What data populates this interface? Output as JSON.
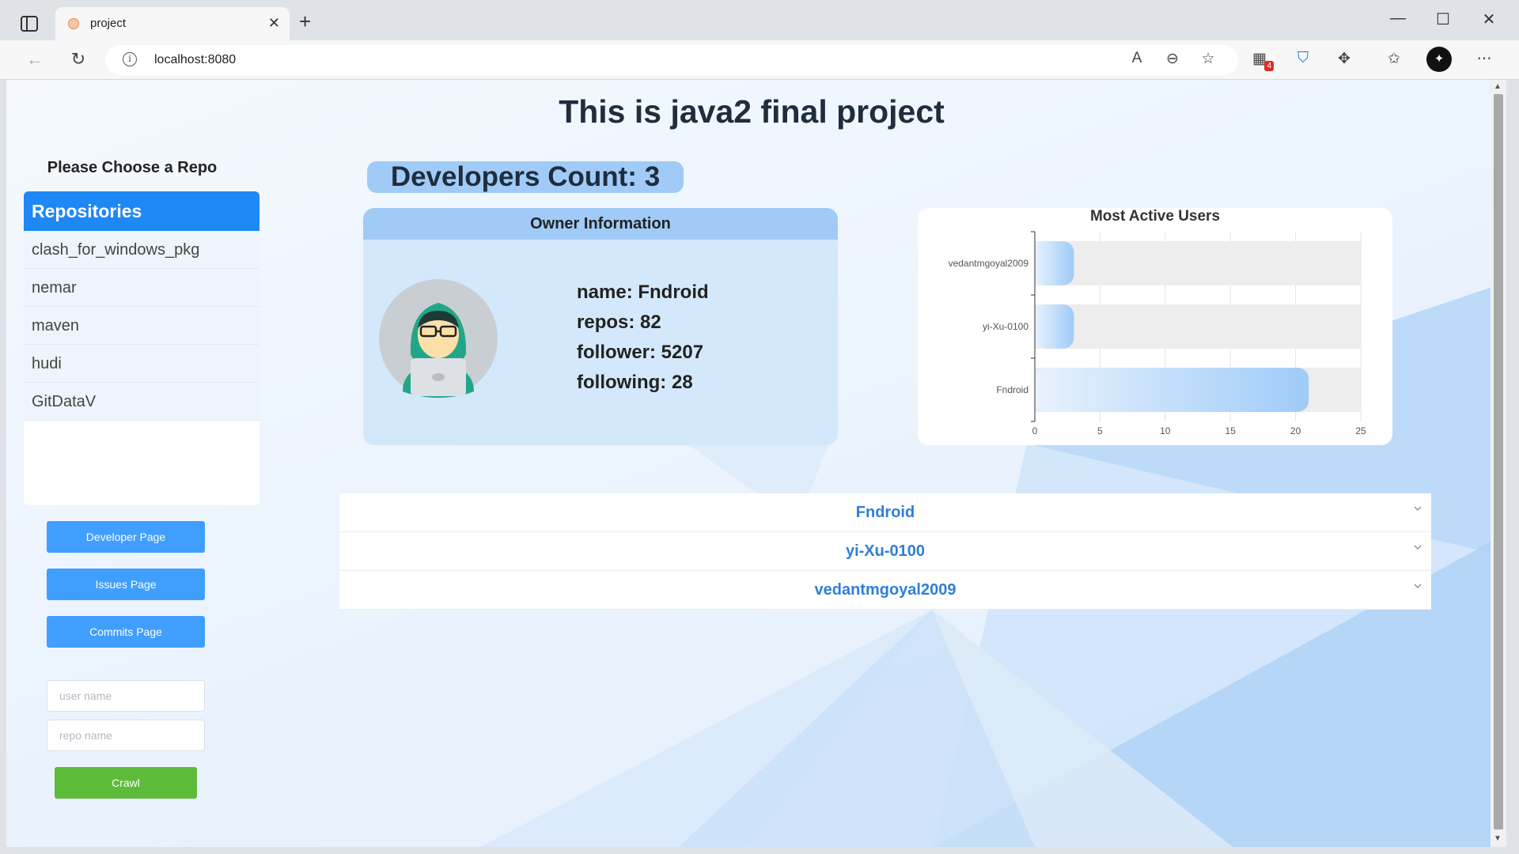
{
  "browser": {
    "tab_title": "project",
    "url": "localhost:8080",
    "extensions_badge": "4",
    "icons": [
      "sidebar-icon",
      "close-icon",
      "plus-icon",
      "minimize-icon",
      "maximize-icon",
      "back-icon",
      "refresh-icon",
      "info-icon",
      "read-aloud-icon",
      "zoom-out-icon",
      "favorite-add-icon",
      "extensions-icon",
      "shield-icon",
      "puzzle-icon",
      "favorites-icon",
      "profile-icon",
      "more-icon"
    ]
  },
  "page": {
    "title": "This is java2 final project"
  },
  "sidebar": {
    "choose_label": "Please Choose a Repo",
    "repo_header": "Repositories",
    "repos": [
      "clash_for_windows_pkg",
      "nemar",
      "maven",
      "hudi",
      "GitDataV"
    ],
    "buttons": {
      "developer": "Developer Page",
      "issues": "Issues Page",
      "commits": "Commits Page"
    },
    "inputs": {
      "user_placeholder": "user name",
      "repo_placeholder": "repo name"
    },
    "crawl": "Crawl"
  },
  "developers": {
    "count_label": "Developers Count: 3"
  },
  "owner": {
    "header": "Owner Information",
    "name_line": "name: Fndroid",
    "repos_line": "repos: 82",
    "follower_line": "follower: 5207",
    "following_line": "following: 28"
  },
  "collapse": {
    "items": [
      "Fndroid",
      "yi-Xu-0100",
      "vedantmgoyal2009"
    ]
  },
  "colors": {
    "accent": "#1e88f5",
    "button": "#409eff",
    "crawl": "#5dbb3a",
    "collapse_title": "#2f7fd6"
  },
  "chart_data": {
    "type": "bar",
    "orientation": "horizontal",
    "title": "Most Active Users",
    "categories": [
      "Fndroid",
      "yi-Xu-0100",
      "vedantmgoyal2009"
    ],
    "values": [
      21,
      3,
      3
    ],
    "xlim": [
      0,
      25
    ],
    "xticks": [
      0,
      5,
      10,
      15,
      20,
      25
    ],
    "background_bars": true,
    "grid": true
  }
}
